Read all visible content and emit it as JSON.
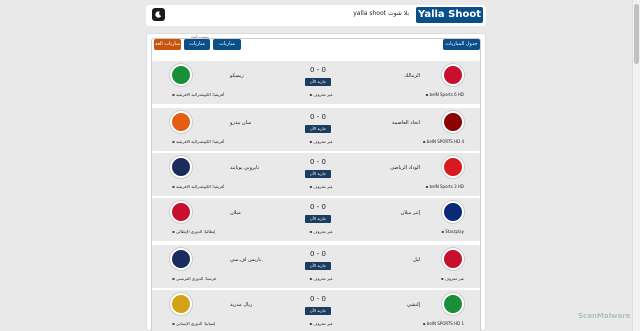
{
  "header": {
    "logo": "Yalla Shoot",
    "nav": [
      "بلا شوت",
      "yalla shoot"
    ],
    "theme_icon": "moon-icon"
  },
  "tab_label": "يوتيوب البث",
  "buttons": {
    "schedule": "جدول المباريات",
    "yesterday": "مباريات الأمس",
    "today": "مباريات اليوم",
    "tomorrow": "مباريات الغد"
  },
  "matches": [
    {
      "home": "الزمالك",
      "away": "زيسكو",
      "score": "0 - 0",
      "status": "جارية الآن",
      "channel": "beIN Sports 6 HD",
      "commentator": "غير معروف",
      "league": "أفريقيا: الكونفدرالية الافريقية",
      "home_color": "#c8102e",
      "away_color": "#1a8f3a"
    },
    {
      "home": "اتحاد العاصمة",
      "away": "سان بيدرو",
      "score": "0 - 0",
      "status": "جارية الآن",
      "channel": "beIN SPORTS HD 4",
      "commentator": "غير معروف",
      "league": "أفريقيا: الكونفدرالية الافريقية",
      "home_color": "#8b0000",
      "away_color": "#e35d12"
    },
    {
      "home": "الوداد الرياضي",
      "away": "نايروبي يونايتد",
      "score": "0 - 0",
      "status": "جارية الآن",
      "channel": "beIN Sports 3 HD",
      "commentator": "غير معروف",
      "league": "أفريقيا: الكونفدرالية الافريقية",
      "home_color": "#d71920",
      "away_color": "#1a2c5b"
    },
    {
      "home": "إنتر ميلان",
      "away": "ميلان",
      "score": "0 - 0",
      "status": "جارية الآن",
      "channel": "Starzplay",
      "commentator": "غير معروف",
      "league": "إيطاليا: الدوري الإيطالي",
      "home_color": "#0a2a78",
      "away_color": "#c8102e"
    },
    {
      "home": "ليل",
      "away": "باريس اف.سي.",
      "score": "0 - 0",
      "status": "جارية الآن",
      "channel": "غير معروف",
      "commentator": "غير معروف",
      "league": "فرنسا: الدوري الفرنسي",
      "home_color": "#c8102e",
      "away_color": "#1a2c5b"
    },
    {
      "home": "إلتشي",
      "away": "ريال مدريد",
      "score": "0 - 0",
      "status": "جارية الآن",
      "channel": "beIN SPORTS HD 1",
      "commentator": "غير معروف",
      "league": "إسبانيا: الدوري الإسباني",
      "home_color": "#1a8f3a",
      "away_color": "#d4a017"
    }
  ],
  "watermark": "ScanMalware"
}
